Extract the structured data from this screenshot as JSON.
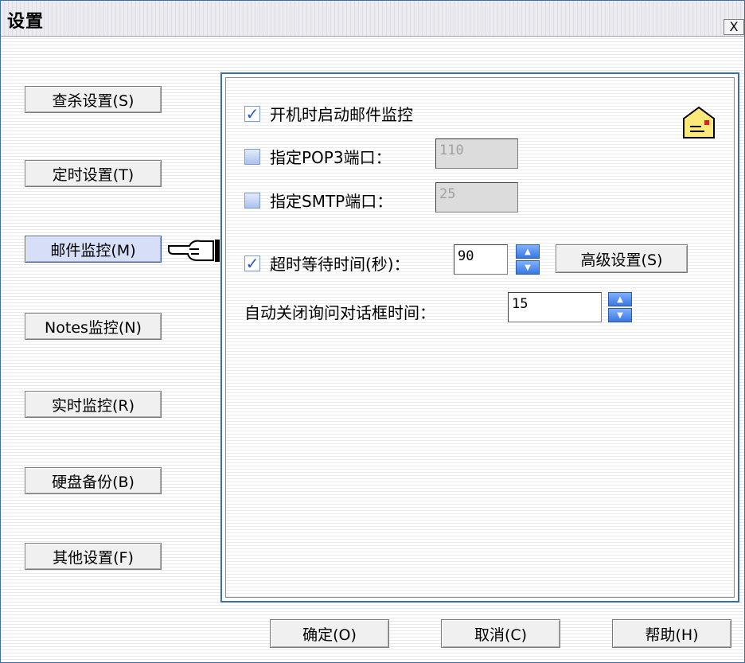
{
  "window": {
    "title": "设置",
    "close_glyph": "X"
  },
  "sidebar": {
    "items": [
      {
        "label": "查杀设置(S)"
      },
      {
        "label": "定时设置(T)"
      },
      {
        "label": "邮件监控(M)"
      },
      {
        "label": "Notes监控(N)"
      },
      {
        "label": "实时监控(R)"
      },
      {
        "label": "硬盘备份(B)"
      },
      {
        "label": "其他设置(F)"
      }
    ],
    "active_index": 2
  },
  "panel": {
    "startup_monitor": {
      "label": "开机时启动邮件监控",
      "checked": true
    },
    "pop3": {
      "label": "指定POP3端口：",
      "checked": false,
      "value": "110"
    },
    "smtp": {
      "label": "指定SMTP端口：",
      "checked": false,
      "value": "25"
    },
    "timeout": {
      "label": "超时等待时间(秒)：",
      "checked": true,
      "value": "90"
    },
    "advanced_button": "高级设置(S)",
    "autoclose": {
      "label": "自动关闭询问对话框时间：",
      "value": "15"
    }
  },
  "footer": {
    "ok": "确定(O)",
    "cancel": "取消(C)",
    "help": "帮助(H)"
  },
  "colors": {
    "accent": "#3a6ea5",
    "check": "#2456d6"
  }
}
